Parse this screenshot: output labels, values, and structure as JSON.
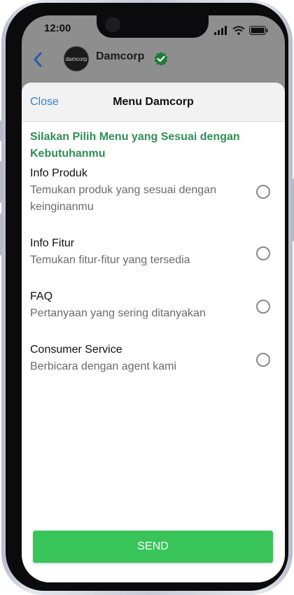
{
  "status_bar": {
    "time": "12:00"
  },
  "chat_header": {
    "avatar_text": "damcorp",
    "contact_name": "Damcorp"
  },
  "sheet": {
    "close_label": "Close",
    "title": "Menu Damcorp",
    "prompt": "Silakan Pilih Menu yang Sesuai dengan Kebutuhanmu",
    "options": [
      {
        "title": "Info Produk",
        "description": "Temukan produk yang sesuai dengan keinginanmu",
        "selected": false
      },
      {
        "title": "Info Fitur",
        "description": "Temukan fitur-fitur yang tersedia",
        "selected": false
      },
      {
        "title": "FAQ",
        "description": "Pertanyaan yang sering ditanyakan",
        "selected": false
      },
      {
        "title": "Consumer Service",
        "description": "Berbicara dengan agent kami",
        "selected": false
      }
    ],
    "send_label": "SEND"
  },
  "colors": {
    "accent_green": "#3ac55a",
    "prompt_green": "#2f8f54",
    "link_blue": "#2a84d6"
  },
  "icons": [
    "back-arrow-icon",
    "verified-badge-icon",
    "signal-icon",
    "wifi-icon",
    "battery-icon",
    "radio-unchecked-icon"
  ]
}
